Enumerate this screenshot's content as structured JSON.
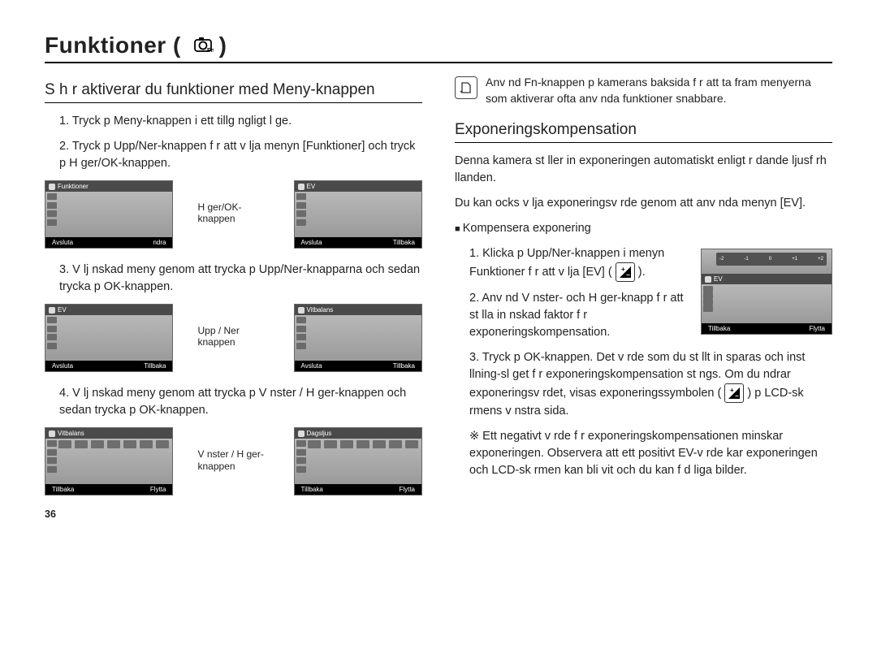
{
  "page_number": "36",
  "title": "Funktioner (",
  "title_close": ")",
  "title_icon": "camera-fn-icon",
  "left": {
    "subhead": "S  h r aktiverar du funktioner med Meny-knappen",
    "step1": "1. Tryck p  Meny-knappen i ett tillg ngligt l ge.",
    "step2": "2. Tryck p  Upp/Ner-knappen f r att v lja menyn [Funktioner] och tryck p  H ger/OK-knappen.",
    "step3": "3. V lj  nskad meny genom att trycka p  Upp/Ner-knapparna och sedan trycka p  OK-knappen.",
    "step4": "4. V lj  nskad meny genom att trycka p  V nster / H ger-knappen och sedan trycka p  OK-knappen.",
    "label_pair1": "H ger/OK-knappen",
    "label_pair2": "Upp / Ner knappen",
    "label_pair3": "V nster / H ger-knappen",
    "shot1": {
      "title": "Funktioner",
      "left": "Avsluta",
      "right": " ndra"
    },
    "shot2": {
      "title": "EV",
      "left": "Avsluta",
      "right": "Tillbaka"
    },
    "shot3": {
      "title": "EV",
      "left": "Avsluta",
      "right": "Tillbaka"
    },
    "shot4": {
      "title": "Vitbalans",
      "left": "Avsluta",
      "right": "Tillbaka"
    },
    "shot5": {
      "title": "Vitbalans",
      "left": "Tillbaka",
      "right": "Flytta"
    },
    "shot6": {
      "title": "Dagsljus",
      "left": "Tillbaka",
      "right": "Flytta"
    }
  },
  "right": {
    "note": "Anv nd Fn-knappen p  kamerans baksida f r att ta fram menyerna som aktiverar ofta anv nda funktioner snabbare.",
    "subhead": "Exponeringskompensation",
    "intro1": "Denna kamera st ller in exponeringen automatiskt enligt r dande ljusf rh llanden.",
    "intro2": "Du kan ocks  v lja exponeringsv rde genom att anv nda menyn [EV].",
    "bullet": "Kompensera exponering",
    "step1a": "1. Klicka p  Upp/Ner-knappen i menyn Funktioner f r att v lja [EV]  (",
    "step1b": ").",
    "step2": "2. Anv nd V nster- och H ger-knapp f r att st lla in  nskad faktor f r exponeringskompensation.",
    "step3a": "3. Tryck p  OK-knappen. Det v rde som du st llt in sparas och inst llning-sl get f r exponeringskompensation st ngs. Om du  ndrar exponeringsv rdet, visas exponeringssymbolen (",
    "step3b": ") p  LCD-sk rmens v nstra sida.",
    "star": "※ Ett negativt v rde f r exponeringskompensationen minskar exponeringen. Observera att ett positivt EV-v rde  kar exponeringen och LCD-sk rmen kan bli vit och du kan f  d liga bilder.",
    "ev_shot": {
      "title": "EV",
      "left": "Tillbaka",
      "right": "Flytta"
    }
  }
}
